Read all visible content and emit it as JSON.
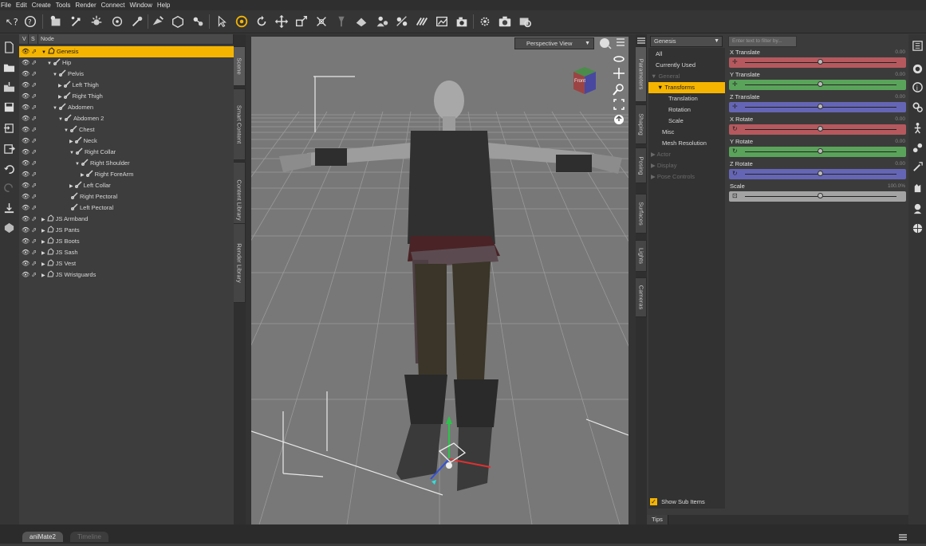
{
  "menu": [
    "File",
    "Edit",
    "Create",
    "Tools",
    "Render",
    "Connect",
    "Window",
    "Help"
  ],
  "scene": {
    "col_v": "V",
    "col_s": "S",
    "col_node": "Node",
    "nodes": [
      {
        "label": "Genesis",
        "depth": 0,
        "arrow": "▼",
        "type": "figure",
        "selected": true
      },
      {
        "label": "Hip",
        "depth": 1,
        "arrow": "▼",
        "type": "bone"
      },
      {
        "label": "Pelvis",
        "depth": 2,
        "arrow": "▼",
        "type": "bone"
      },
      {
        "label": "Left Thigh",
        "depth": 3,
        "arrow": "▶",
        "type": "bone"
      },
      {
        "label": "Right Thigh",
        "depth": 3,
        "arrow": "▶",
        "type": "bone"
      },
      {
        "label": "Abdomen",
        "depth": 2,
        "arrow": "▼",
        "type": "bone"
      },
      {
        "label": "Abdomen 2",
        "depth": 3,
        "arrow": "▼",
        "type": "bone"
      },
      {
        "label": "Chest",
        "depth": 4,
        "arrow": "▼",
        "type": "bone"
      },
      {
        "label": "Neck",
        "depth": 5,
        "arrow": "▶",
        "type": "bone"
      },
      {
        "label": "Right Collar",
        "depth": 5,
        "arrow": "▼",
        "type": "bone"
      },
      {
        "label": "Right Shoulder",
        "depth": 6,
        "arrow": "▼",
        "type": "bone"
      },
      {
        "label": "Right ForeArm",
        "depth": 7,
        "arrow": "▶",
        "type": "bone"
      },
      {
        "label": "Left Collar",
        "depth": 5,
        "arrow": "▶",
        "type": "bone"
      },
      {
        "label": "Right Pectoral",
        "depth": 5,
        "arrow": "",
        "type": "bone"
      },
      {
        "label": "Left Pectoral",
        "depth": 5,
        "arrow": "",
        "type": "bone"
      },
      {
        "label": "JS Armband",
        "depth": 0,
        "arrow": "▶",
        "type": "figure"
      },
      {
        "label": "JS Pants",
        "depth": 0,
        "arrow": "▶",
        "type": "figure"
      },
      {
        "label": "JS Boots",
        "depth": 0,
        "arrow": "▶",
        "type": "figure"
      },
      {
        "label": "JS Sash",
        "depth": 0,
        "arrow": "▶",
        "type": "figure"
      },
      {
        "label": "JS Vest",
        "depth": 0,
        "arrow": "▶",
        "type": "figure"
      },
      {
        "label": "JS Wristguards",
        "depth": 0,
        "arrow": "▶",
        "type": "figure"
      }
    ]
  },
  "scene_tabs": [
    "Scene",
    "Smart Content",
    "Content Library",
    "Render Library"
  ],
  "viewport": {
    "view_label": "Perspective View",
    "cube_label": "Front"
  },
  "param_tabs": [
    "Parameters",
    "Shaping",
    "Posing",
    "Surfaces",
    "Lights",
    "Cameras"
  ],
  "params": {
    "node_select": "Genesis",
    "filter_placeholder": "Enter text to filter by...",
    "tree": [
      {
        "label": "All",
        "depth": 0,
        "state": "normal"
      },
      {
        "label": "Currently Used",
        "depth": 0,
        "state": "normal"
      },
      {
        "label": "▼ General",
        "depth": 0,
        "state": "dim"
      },
      {
        "label": "▼ Transforms",
        "depth": 1,
        "state": "selected"
      },
      {
        "label": "Translation",
        "depth": 2,
        "state": "normal"
      },
      {
        "label": "Rotation",
        "depth": 2,
        "state": "normal"
      },
      {
        "label": "Scale",
        "depth": 2,
        "state": "normal"
      },
      {
        "label": "Misc",
        "depth": 1,
        "state": "normal"
      },
      {
        "label": "Mesh Resolution",
        "depth": 1,
        "state": "normal"
      },
      {
        "label": "▶ Actor",
        "depth": 0,
        "state": "dim"
      },
      {
        "label": "▶ Display",
        "depth": 0,
        "state": "dim"
      },
      {
        "label": "▶ Pose Controls",
        "depth": 0,
        "state": "dim"
      }
    ],
    "sliders": [
      {
        "name": "X Translate",
        "value": "0.00",
        "color": "#b5595e",
        "glyph": "✛",
        "fraction": 0.5
      },
      {
        "name": "Y Translate",
        "value": "0.00",
        "color": "#5aa35a",
        "glyph": "✛",
        "fraction": 0.5
      },
      {
        "name": "Z Translate",
        "value": "0.00",
        "color": "#6565b5",
        "glyph": "✛",
        "fraction": 0.5
      },
      {
        "name": "X Rotate",
        "value": "0.00",
        "color": "#b5595e",
        "glyph": "↻",
        "fraction": 0.5
      },
      {
        "name": "Y Rotate",
        "value": "0.00",
        "color": "#5aa35a",
        "glyph": "↻",
        "fraction": 0.5
      },
      {
        "name": "Z Rotate",
        "value": "0.00",
        "color": "#6565b5",
        "glyph": "↻",
        "fraction": 0.5
      },
      {
        "name": "Scale",
        "value": "100.0%",
        "color": "#a3a3a3",
        "glyph": "⊡",
        "fraction": 0.5
      }
    ],
    "show_sub_items": "Show Sub Items",
    "tips_tab": "Tips"
  },
  "bottom_tabs": [
    "aniMate2",
    "Timeline"
  ],
  "colors": {
    "accent": "#f5b400",
    "x_axis": "#b5595e",
    "y_axis": "#5aa35a",
    "z_axis": "#6565b5"
  }
}
